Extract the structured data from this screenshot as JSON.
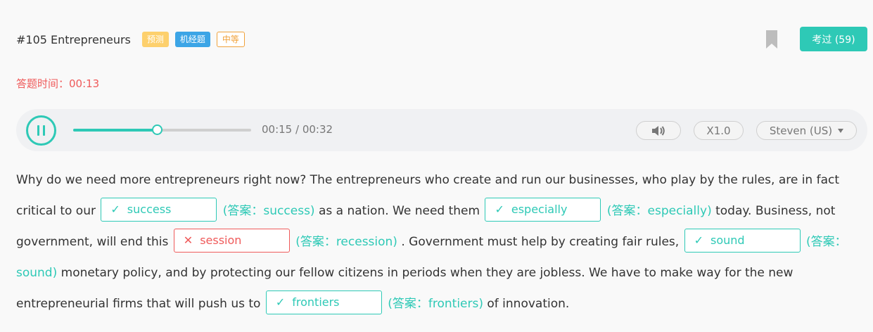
{
  "header": {
    "title": "#105 Entrepreneurs",
    "tags": [
      "预测",
      "机经题",
      "中等"
    ],
    "pass_button": "考过 (59)"
  },
  "timer": {
    "label": "答题时间：00:13"
  },
  "player": {
    "progress_fraction": 0.4688,
    "time_display": "00:15 / 00:32",
    "speed": "X1.0",
    "voice": "Steven (US)"
  },
  "passage": {
    "seg_1": "Why do we need more entrepreneurs right now? The entrepreneurs who create and run our businesses, who play by the rules, are in fact critical to our",
    "seg_2": "as a nation. We need them",
    "seg_3": "today. Business, not government, will end this",
    "seg_4": ". Government must help by creating fair rules,",
    "seg_5": "monetary policy, and by protecting our fellow citizens in periods when they are jobless. We have to make way for the new entrepreneurial firms that will push us to",
    "seg_6": "of innovation.",
    "blanks": [
      {
        "mark": "✓",
        "value": "success",
        "answer": "(答案：success)",
        "status": "correct"
      },
      {
        "mark": "✓",
        "value": "especially",
        "answer": "(答案：especially)",
        "status": "correct"
      },
      {
        "mark": "✕",
        "value": "session",
        "answer": "(答案：recession)",
        "status": "wrong"
      },
      {
        "mark": "✓",
        "value": "sound",
        "answer": "(答案：sound)",
        "status": "correct"
      },
      {
        "mark": "✓",
        "value": "frontiers",
        "answer": "(答案：frontiers)",
        "status": "correct"
      }
    ]
  },
  "colors": {
    "accent": "#2ec9b6",
    "error": "#ef5a5a",
    "tag_yellow": "#fdd06d",
    "tag_blue": "#3ca5e6",
    "tag_orange": "#f0a23b"
  },
  "icons": {
    "pause": "pause-icon",
    "volume": "volume-icon",
    "bookmark": "bookmark-icon"
  }
}
